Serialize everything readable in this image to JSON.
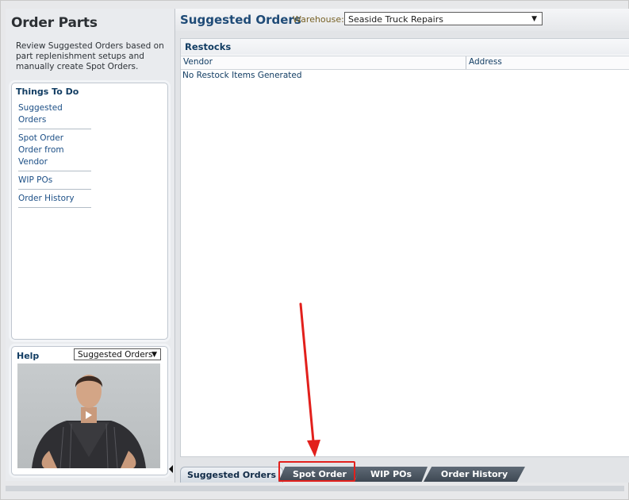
{
  "sidebar": {
    "title": "Order Parts",
    "description": "Review Suggested Orders based on part replenishment setups and manually create Spot Orders.",
    "things_to_do": {
      "heading": "Things To Do",
      "items": [
        {
          "label": "Suggested Orders"
        },
        {
          "label": "Spot Order\nOrder from Vendor"
        },
        {
          "label": "WIP POs"
        },
        {
          "label": "Order History"
        }
      ]
    },
    "help": {
      "heading": "Help",
      "topic": "Suggested Orders",
      "video_icon": "play-icon"
    }
  },
  "main": {
    "title": "Suggested Orders",
    "warehouse_label": "Warehouse:",
    "warehouse_value": "Seaside Truck Repairs",
    "restocks": {
      "title": "Restocks",
      "columns": [
        "Vendor",
        "Address"
      ],
      "empty_message": "No Restock Items Generated"
    },
    "tabs": [
      {
        "label": "Suggested Orders",
        "active": true
      },
      {
        "label": "Spot Order",
        "active": false
      },
      {
        "label": "WIP POs",
        "active": false
      },
      {
        "label": "Order History",
        "active": false
      }
    ]
  },
  "annotation": {
    "color": "#e2201c"
  }
}
